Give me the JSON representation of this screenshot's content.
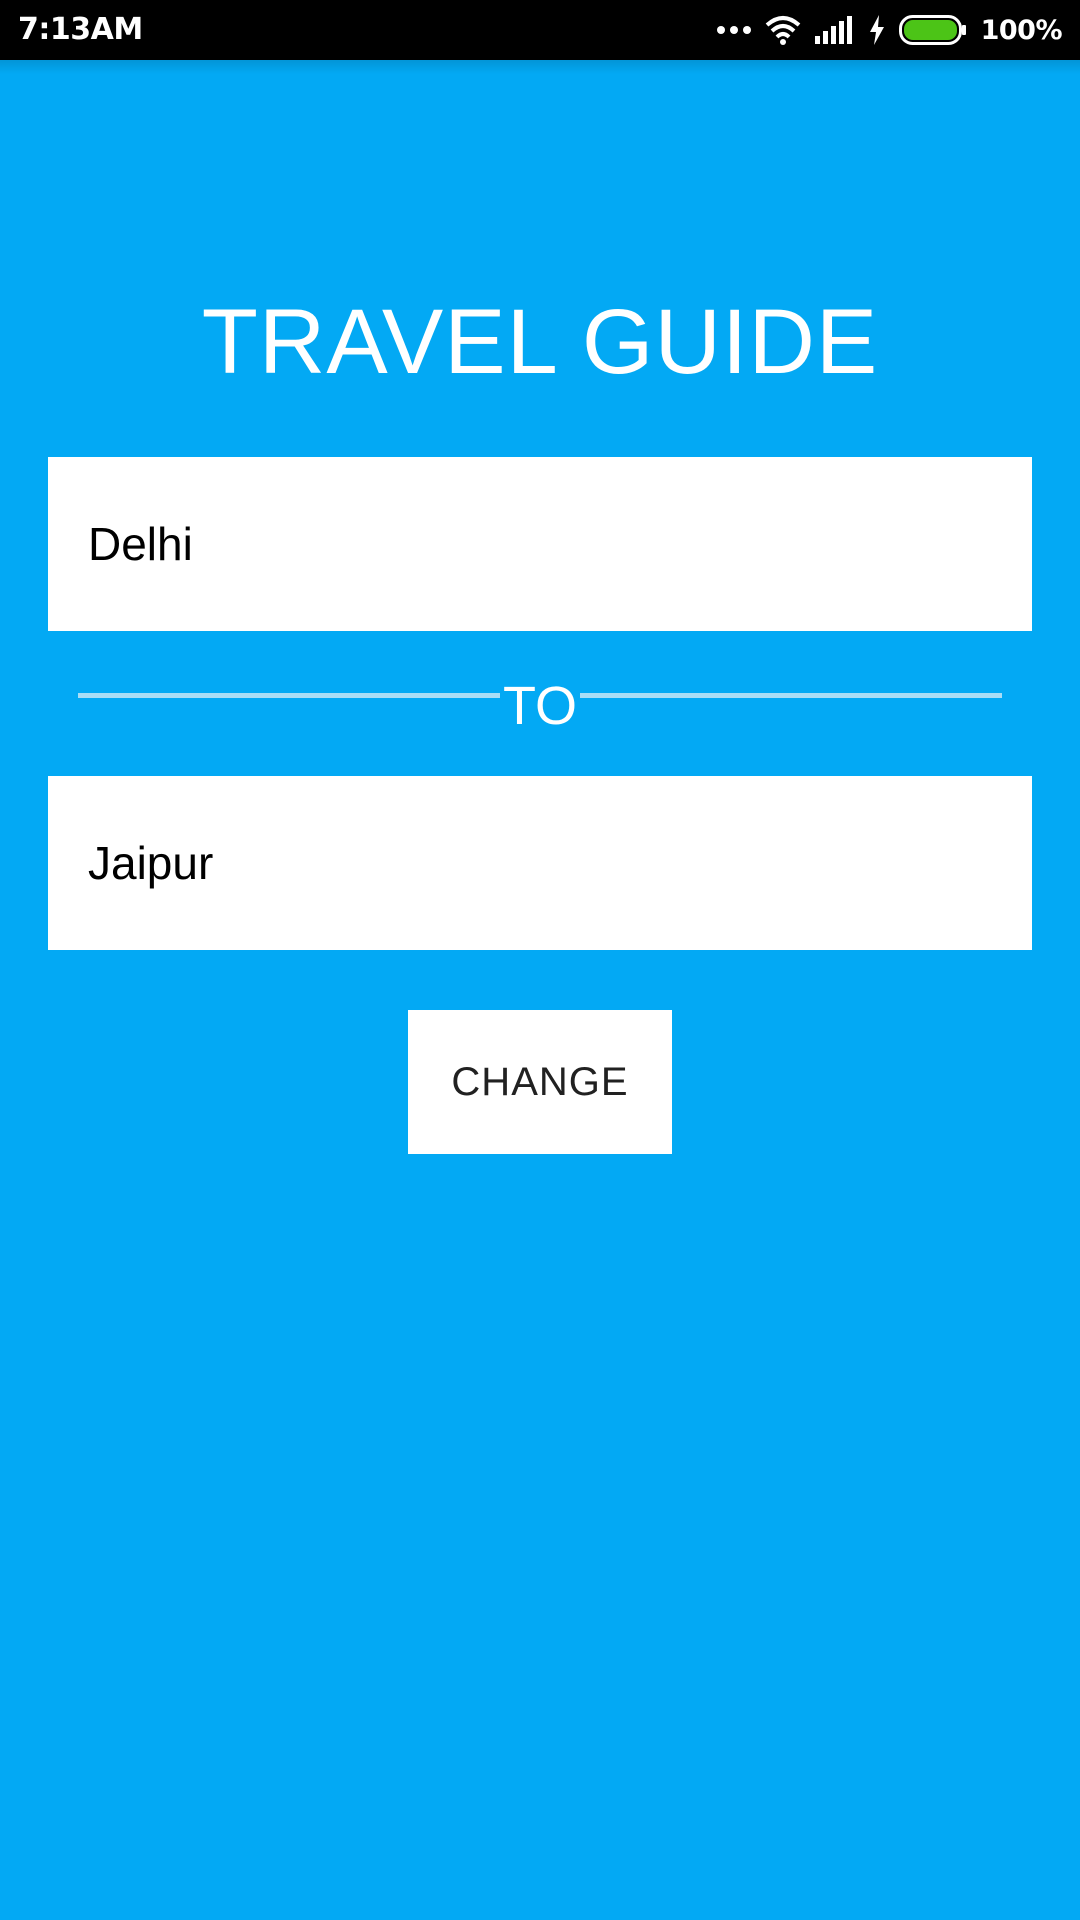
{
  "status_bar": {
    "time": "7:13AM",
    "battery_percent": "100%",
    "icons": [
      "more-dots-icon",
      "wifi-icon",
      "signal-icon",
      "charging-icon",
      "battery-icon"
    ],
    "battery_color": "#4CC417"
  },
  "app": {
    "title": "TRAVEL GUIDE",
    "background_color": "#03A9F4"
  },
  "route": {
    "from_value": "Delhi",
    "separator_label": "TO",
    "to_value": "Jaipur"
  },
  "actions": {
    "change_label": "CHANGE"
  }
}
